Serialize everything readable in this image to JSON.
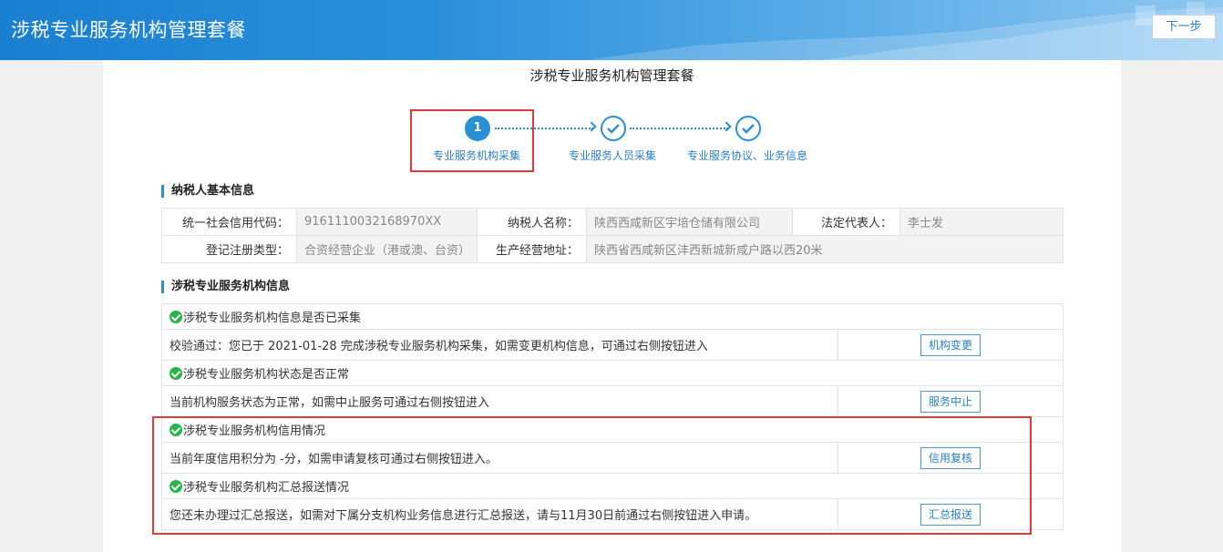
{
  "header": {
    "title": "涉税专业服务机构管理套餐",
    "next_label": "下一步"
  },
  "page": {
    "title": "涉税专业服务机构管理套餐"
  },
  "steps": [
    {
      "number": "1",
      "label": "专业服务机构采集"
    },
    {
      "label": "专业服务人员采集"
    },
    {
      "label": "专业服务协议、业务信息"
    }
  ],
  "taxpayer": {
    "section_title": "纳税人基本信息",
    "credit_code_label": "统一社会信用代码：",
    "credit_code": "9161110032168970XX",
    "name_label": "纳税人名称：",
    "name": "陕西西咸新区宇培仓储有限公司",
    "legal_rep_label": "法定代表人：",
    "legal_rep": "李士发",
    "reg_type_label": "登记注册类型：",
    "reg_type": "合资经营企业（港或澳、台资）",
    "address_label": "生产经营地址：",
    "address": "陕西省西咸新区沣西新城新咸户路以西20米"
  },
  "org": {
    "section_title": "涉税专业服务机构信息",
    "items": [
      {
        "title": "涉税专业服务机构信息是否已采集",
        "desc": "校验通过：您已于 2021-01-28 完成涉税专业服务机构采集，如需变更机构信息，可通过右侧按钮进入",
        "button": "机构变更"
      },
      {
        "title": "涉税专业服务机构状态是否正常",
        "desc": "当前机构服务状态为正常，如需中止服务可通过右侧按钮进入",
        "button": "服务中止"
      },
      {
        "title": "涉税专业服务机构信用情况",
        "desc": "当前年度信用积分为 -分，如需申请复核可通过右侧按钮进入。",
        "button": "信用复核"
      },
      {
        "title": "涉税专业服务机构汇总报送情况",
        "desc": "您还未办理过汇总报送，如需对下属分支机构业务信息进行汇总报送，请与11月30日前通过右侧按钮进入申请。",
        "button": "汇总报送"
      }
    ]
  },
  "colors": {
    "header": "#1a7fd0",
    "accent": "#2a8fd4",
    "highlight": "#e03a3a",
    "ok": "#27b44a"
  }
}
